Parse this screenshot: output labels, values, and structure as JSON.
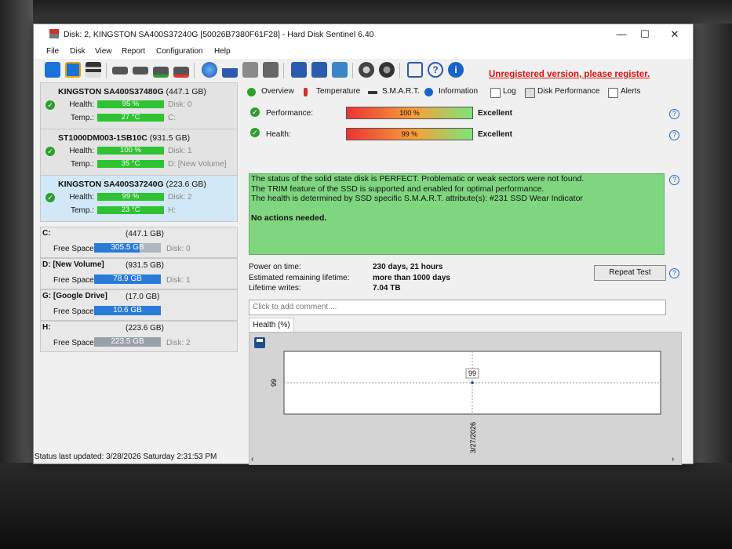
{
  "window": {
    "title": "Disk: 2, KINGSTON SA400S37240G [50026B7380F61F28]  -  Hard Disk Sentinel 6.40"
  },
  "menu": [
    "File",
    "Disk",
    "View",
    "Report",
    "Configuration",
    "Help"
  ],
  "unregistered": "Unregistered version, please register.",
  "disks": [
    {
      "name": "KINGSTON SA400S37480G",
      "size": "(447.1 GB)",
      "health_label": "Health:",
      "health": "95 %",
      "health_value": 95,
      "temp_label": "Temp.:",
      "temp": "27 °C",
      "disk": "Disk: 0",
      "vol": "C:"
    },
    {
      "name": "ST1000DM003-1SB10C",
      "size": "(931.5 GB)",
      "health_label": "Health:",
      "health": "100 %",
      "health_value": 100,
      "temp_label": "Temp.:",
      "temp": "35 °C",
      "disk": "Disk: 1",
      "vol": "D: [New Volume]"
    },
    {
      "name": "KINGSTON SA400S37240G",
      "size": "(223.6 GB)",
      "health_label": "Health:",
      "health": "99 %",
      "health_value": 99,
      "temp_label": "Temp.:",
      "temp": "23 °C",
      "disk": "Disk: 2",
      "vol": "H:"
    }
  ],
  "volumes": [
    {
      "name": "C:",
      "size": "(447.1 GB)",
      "free_label": "Free Space",
      "free": "305.5 GB",
      "free_fraction": 0.68,
      "disk": "Disk: 0"
    },
    {
      "name": "D: [New Volume]",
      "size": "(931.5 GB)",
      "free_label": "Free Space",
      "free": "78.9 GB",
      "free_fraction": 0.08,
      "disk": "Disk: 1"
    },
    {
      "name": "G: [Google Drive]",
      "size": "(17.0 GB)",
      "free_label": "Free Space",
      "free": "10.6 GB",
      "free_fraction": 0.62,
      "disk": ""
    },
    {
      "name": "H:",
      "size": "(223.6 GB)",
      "free_label": "Free Space",
      "free": "223.5 GB",
      "free_fraction": 1.0,
      "disk": "Disk: 2"
    }
  ],
  "tabs": [
    "Overview",
    "Temperature",
    "S.M.A.R.T.",
    "Information",
    "Log",
    "Disk Performance",
    "Alerts"
  ],
  "overview": {
    "performance_label": "Performance:",
    "performance": "100 %",
    "performance_value": 100,
    "performance_text": "Excellent",
    "health_label": "Health:",
    "health": "99 %",
    "health_value": 99,
    "health_text": "Excellent",
    "message_lines": [
      "The status of the solid state disk is PERFECT. Problematic or weak sectors were not found.",
      "The TRIM feature of the SSD is supported and enabled for optimal performance.",
      "The health is determined by SSD specific S.M.A.R.T. attribute(s):  #231 SSD Wear Indicator",
      "",
      "No actions needed."
    ],
    "power_on_label": "Power on time:",
    "power_on": "230 days, 21 hours",
    "remaining_label": "Estimated remaining lifetime:",
    "remaining": "more than 1000 days",
    "writes_label": "Lifetime writes:",
    "writes": "7.04 TB",
    "repeat_test": "Repeat Test",
    "comment_placeholder": "Click to add comment ..."
  },
  "graph_tab": "Health (%)",
  "chart_data": {
    "type": "line",
    "title": "Health (%)",
    "x": [
      "3/27/2026"
    ],
    "series": [
      {
        "values": [
          99
        ]
      }
    ],
    "data_labels": [
      "99"
    ],
    "ytick": "99"
  },
  "status": "Status last updated: 3/28/2026 Saturday 2:31:53 PM",
  "colors": {
    "accent": "#2a7bd8",
    "ok": "#2fc232",
    "danger": "#d11111",
    "message_bg": "#7fd67f"
  }
}
